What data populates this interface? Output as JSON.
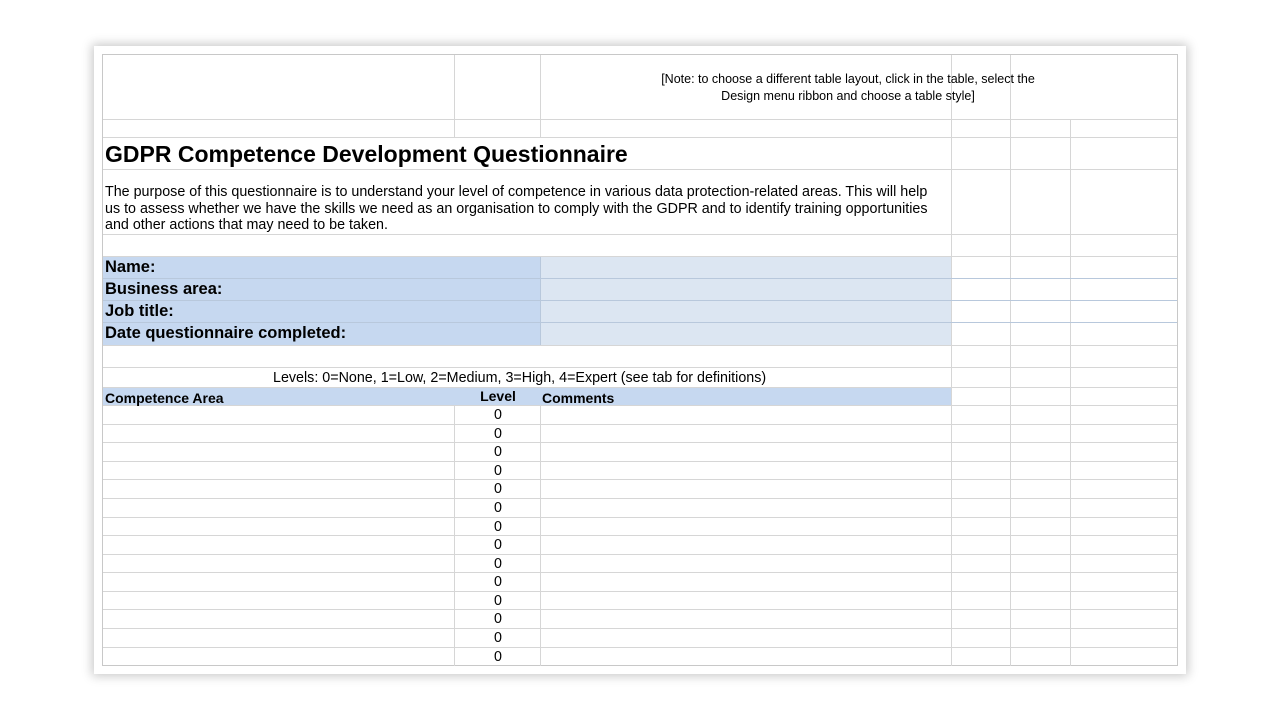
{
  "note": "[Note: to choose a different table layout,  click in the table, select the Design menu ribbon and choose a  table style]",
  "title": "GDPR Competence Development Questionnaire",
  "purpose": "The purpose of this questionnaire is to understand your level of competence in various data protection-related areas. This will help us to assess whether we have the skills we need as an organisation to comply with the GDPR and to identify training opportunities and other actions that may need to be taken.",
  "form_fields": [
    {
      "label": "Name:",
      "value": ""
    },
    {
      "label": "Business area:",
      "value": ""
    },
    {
      "label": "Job title:",
      "value": ""
    },
    {
      "label": "Date questionnaire completed:",
      "value": ""
    }
  ],
  "levels_legend": "Levels: 0=None, 1=Low, 2=Medium, 3=High, 4=Expert (see tab for definitions)",
  "table": {
    "headers": [
      "Competence Area",
      "Level",
      "Comments"
    ],
    "rows": [
      {
        "area": "",
        "level": "0",
        "comments": ""
      },
      {
        "area": "",
        "level": "0",
        "comments": ""
      },
      {
        "area": "",
        "level": "0",
        "comments": ""
      },
      {
        "area": "",
        "level": "0",
        "comments": ""
      },
      {
        "area": "",
        "level": "0",
        "comments": ""
      },
      {
        "area": "",
        "level": "0",
        "comments": ""
      },
      {
        "area": "",
        "level": "0",
        "comments": ""
      },
      {
        "area": "",
        "level": "0",
        "comments": ""
      },
      {
        "area": "",
        "level": "0",
        "comments": ""
      },
      {
        "area": "",
        "level": "0",
        "comments": ""
      },
      {
        "area": "",
        "level": "0",
        "comments": ""
      },
      {
        "area": "",
        "level": "0",
        "comments": ""
      },
      {
        "area": "",
        "level": "0",
        "comments": ""
      },
      {
        "area": "",
        "level": "0",
        "comments": ""
      }
    ]
  },
  "colors": {
    "label_fill": "#c6d8f0",
    "input_fill": "#dce6f2",
    "header_fill": "#c6d8f0",
    "gridline": "#d6d6d6"
  }
}
